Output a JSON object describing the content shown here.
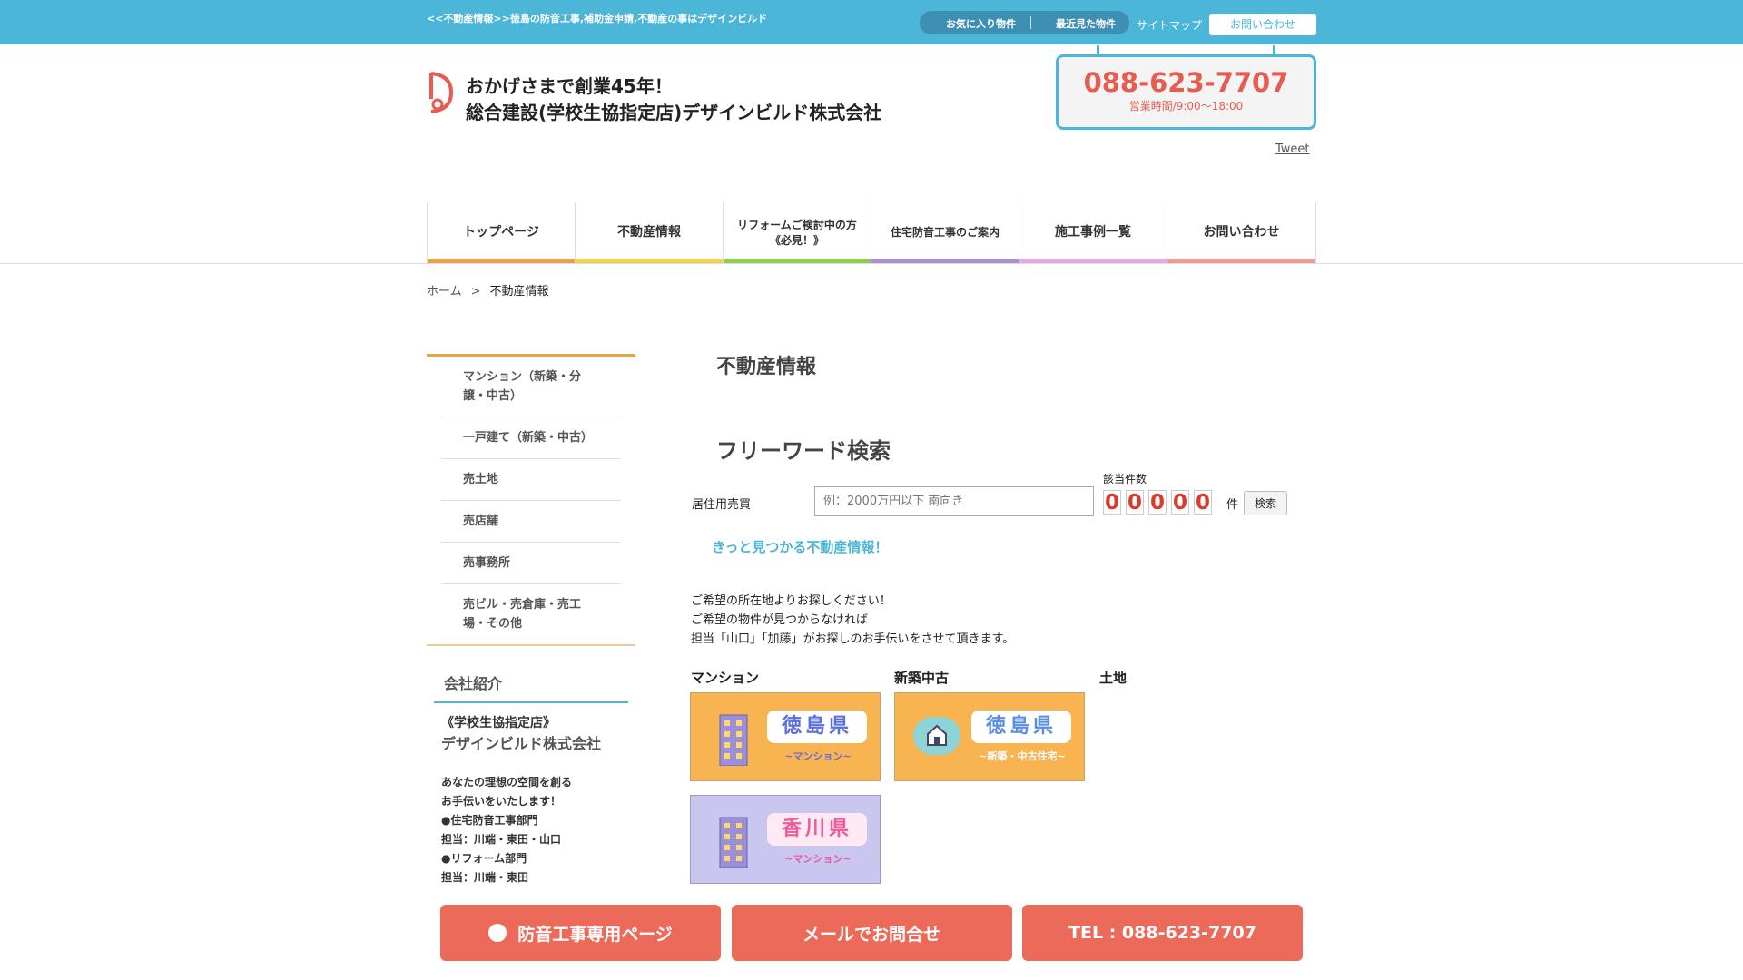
{
  "topbar": {
    "tagline": "<<不動産情報>>徳島の防音工事,補助金申請,不動産の事はデザインビルド",
    "favorites": "お気に入り物件",
    "recent": "最近見た物件",
    "sitemap": "サイトマップ",
    "contact": "お問い合わせ"
  },
  "header": {
    "brand_line1": "おかげさまで創業45年！",
    "brand_line2": "総合建設(学校生協指定店)デザインビルド株式会社",
    "phone": "088-623-7707",
    "hours": "営業時間/9:00〜18:00",
    "tweet": "Tweet"
  },
  "nav": [
    {
      "label": "トップページ",
      "color": "#e8a24a"
    },
    {
      "label": "不動産情報",
      "color": "#f2d34a"
    },
    {
      "label": "リフォームご検討中の方\n《必見！》",
      "color": "#8fce4a"
    },
    {
      "label": "住宅防音工事のご案内",
      "color": "#a98fd2"
    },
    {
      "label": "施工事例一覧",
      "color": "#e9a6e4"
    },
    {
      "label": "お問い合わせ",
      "color": "#ef9a95"
    }
  ],
  "breadcrumb": {
    "home": "ホーム",
    "sep": ">",
    "current": "不動産情報"
  },
  "sidebar": {
    "items": [
      "マンション（新築・分譲・中古）",
      "一戸建て（新築・中古）",
      "売土地",
      "売店舗",
      "売事務所",
      "売ビル・売倉庫・売工場・その他"
    ]
  },
  "company": {
    "heading": "会社紹介",
    "sub": "《学校生協指定店》",
    "name": "デザインビルド株式会社",
    "lines": [
      "あなたの理想の空間を創る",
      "お手伝いをいたします！",
      "●住宅防音工事部門",
      "担当：川端・東田・山口",
      "●リフォーム部門",
      "担当：川端・東田"
    ]
  },
  "main": {
    "title": "不動産情報",
    "search_title": "フリーワード検索",
    "search_label": "居住用売買",
    "search_placeholder": "例：2000万円以下 南向き",
    "count_label": "該当件数",
    "count_digits": [
      "0",
      "0",
      "0",
      "0",
      "0"
    ],
    "count_unit": "件",
    "search_button": "検索",
    "promo": "きっと見つかる不動産情報！",
    "intro": [
      "ご希望の所在地よりお探しください！",
      "ご希望の物件が見つからなければ",
      "担当「山口」「加藤」がお探しのお手伝いをさせて頂きます。"
    ],
    "categories": [
      "マンション",
      "新築中古",
      "土地"
    ],
    "tiles": [
      {
        "pref": "徳島県",
        "sub": "~マンション~",
        "bg": "#f7b451",
        "color": "#5a6ee0",
        "subcolor": "#6a6ad8"
      },
      {
        "pref": "徳島県",
        "sub": "~新築・中古住宅~",
        "bg": "#f7b451",
        "color": "#5a8ee0",
        "subcolor": "#ffffff"
      },
      {
        "pref": "香川県",
        "sub": "~マンション~",
        "bg": "#c9c6f0",
        "color": "#ee5a9a",
        "subcolor": "#ee5a9a"
      }
    ]
  },
  "float_bar": {
    "soundproof": "防音工事専用ページ",
    "mail": "メールでお問合せ",
    "tel": "TEL : 088-623-7707"
  }
}
